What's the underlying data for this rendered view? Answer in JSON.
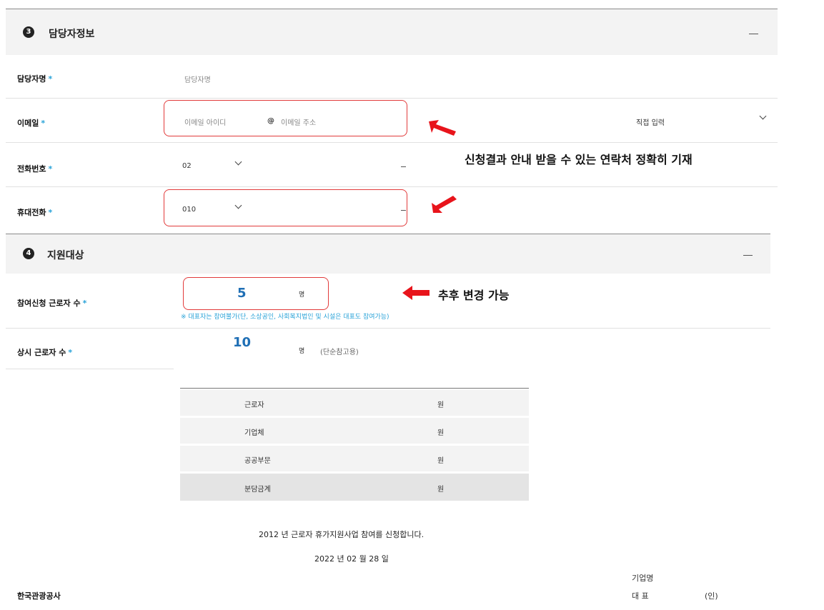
{
  "section3": {
    "number": "3",
    "title": "담당자정보",
    "fields": {
      "manager_name": {
        "label": "담당자명",
        "required": "*",
        "placeholder": "담당자명"
      },
      "email": {
        "label": "이메일",
        "required": "*",
        "id_placeholder": "이메일 아이디",
        "at": "@",
        "domain_placeholder": "이메일 주소",
        "select_value": "직접 입력"
      },
      "phone": {
        "label": "전화번호",
        "required": "*",
        "area_code": "02",
        "separator": "–"
      },
      "mobile": {
        "label": "휴대전화",
        "required": "*",
        "prefix": "010",
        "separator": "–"
      }
    }
  },
  "section4": {
    "number": "4",
    "title": "지원대상",
    "fields": {
      "participants": {
        "label": "참여신청 근로자 수",
        "required": "*",
        "value": "5",
        "unit": "명",
        "notice": "※ 대표자는 참여불가(단, 소상공인, 사회복지법인 및 시설은 대표도 참여가능)"
      },
      "regular_workers": {
        "label": "상시 근로자 수",
        "required": "*",
        "value": "10",
        "unit": "명",
        "note": "(단순참고용)"
      }
    }
  },
  "annotations": {
    "contact_note": "신청결과 안내 받을 수 있는 연락처 정확히 기재",
    "change_note": "추후 변경 가능"
  },
  "summary_table": {
    "rows": [
      {
        "label": "근로자",
        "unit": "원"
      },
      {
        "label": "기업체",
        "unit": "원"
      },
      {
        "label": "공공부문",
        "unit": "원"
      },
      {
        "label": "분담금계",
        "unit": "원"
      }
    ]
  },
  "declaration": {
    "statement": "2012 년 근로자 휴가지원사업 참여를 신청합니다.",
    "date": "2022 년 02 월 28 일"
  },
  "footer": {
    "org": "한국관광공사",
    "company_label": "기업명",
    "rep_label": "대 표",
    "seal": "(인)"
  },
  "colors": {
    "required": "#2aa3d8",
    "highlight": "#e23b3b",
    "value_blue": "#1f6fb5",
    "section_bg": "#f3f3f3"
  },
  "icons": [
    "chevron-down-icon",
    "collapse-icon",
    "red-arrow-icon"
  ]
}
